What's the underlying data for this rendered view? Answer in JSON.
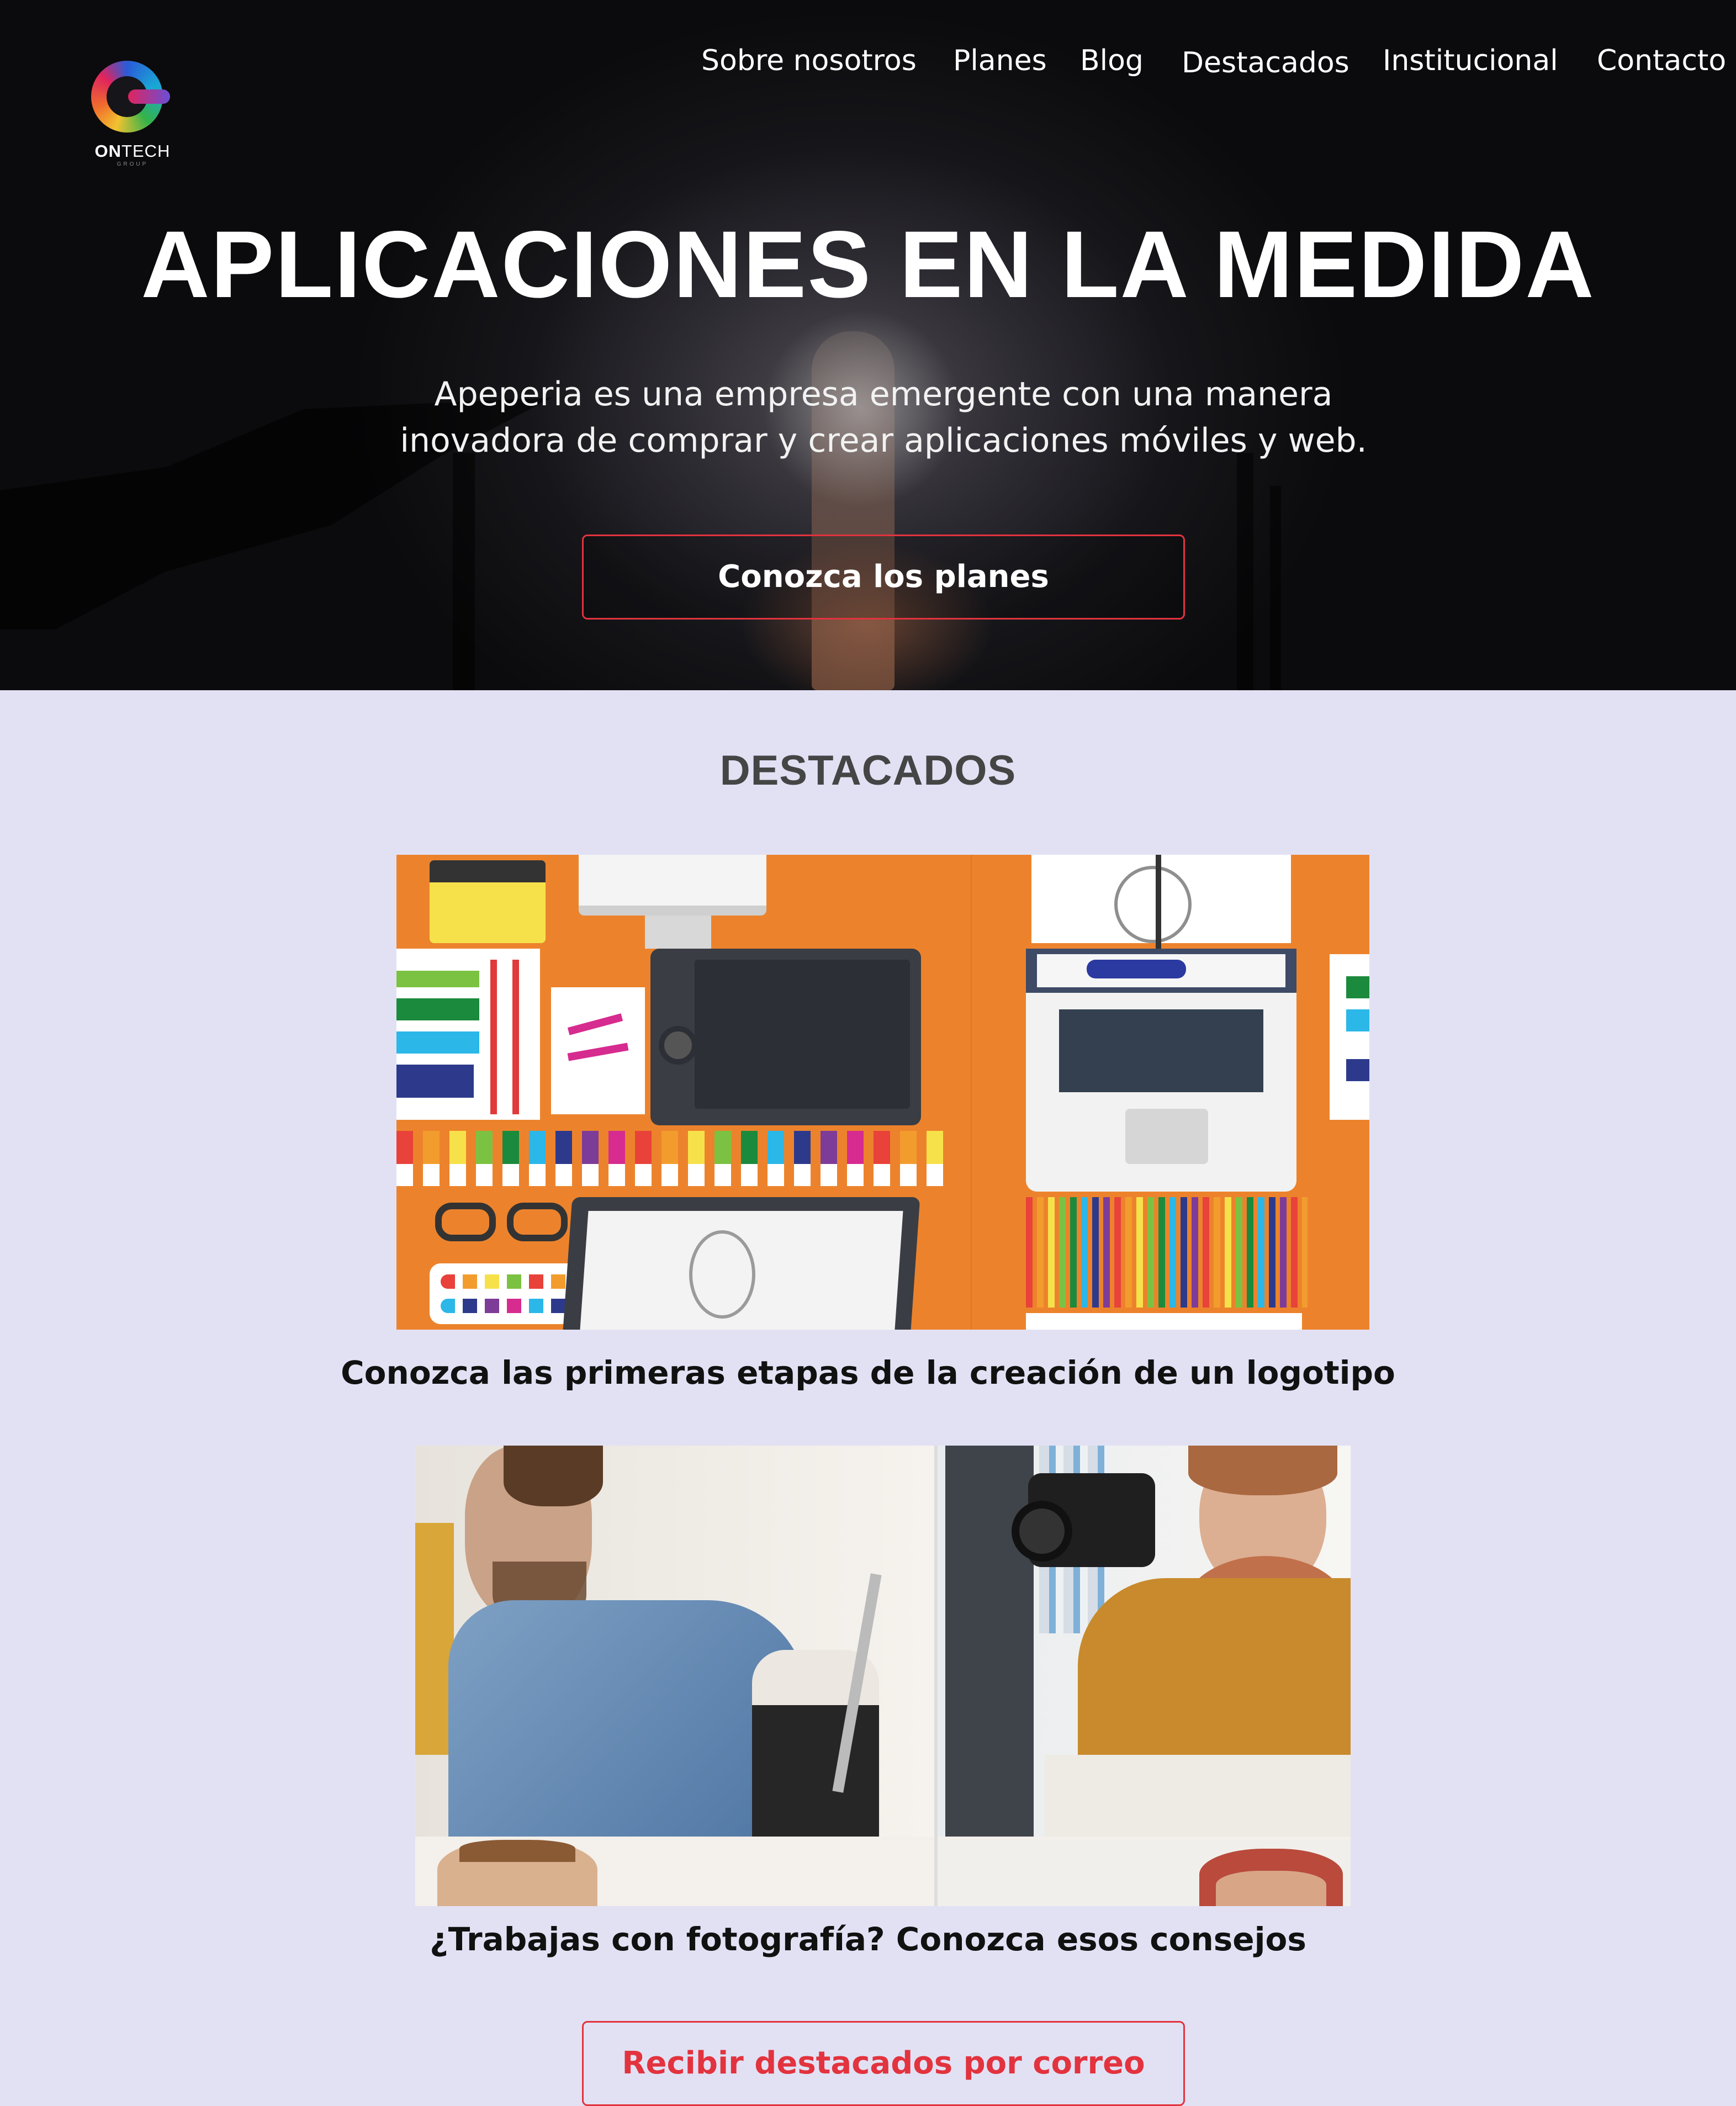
{
  "brand": {
    "logo_name_bold": "ON",
    "logo_name_light": "TECH",
    "logo_sub": "GROUP"
  },
  "nav": {
    "items": [
      {
        "label": "Sobre nosotros"
      },
      {
        "label": "Planes"
      },
      {
        "label": "Blog"
      },
      {
        "label": "Destacados"
      },
      {
        "label": "Institucional"
      },
      {
        "label": "Contacto"
      }
    ]
  },
  "hero": {
    "title": "APLICACIONES EN LA MEDIDA",
    "description_line1": "Apeperia es una empresa emergente con una manera",
    "description_line2": "inovadora de comprar y crear aplicaciones móviles y web.",
    "button_label": "Conozca los planes"
  },
  "featured": {
    "title": "DESTACADOS",
    "cards": [
      {
        "caption": "Conozca las primeras etapas de la creación de un logotipo",
        "image": "design-desk-illustration"
      },
      {
        "caption": "¿Trabajas con fotografía? Conozca esos consejos",
        "image": "photographers-photo"
      }
    ],
    "subscribe_button": "Recibir destacados por correo"
  },
  "colors": {
    "accent": "#e2333e",
    "page_bg": "#e2e1f4",
    "illustration_orange": "#ec832c"
  }
}
